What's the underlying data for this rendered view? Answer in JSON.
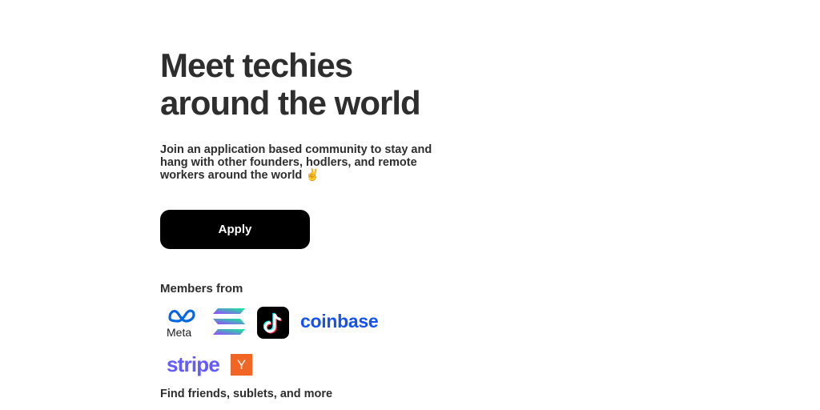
{
  "hero": {
    "title_line_1": "Meet techies",
    "title_line_2": "around the world",
    "subtitle_line_1": "Join an application based community to stay and",
    "subtitle_line_2": "hang with other founders,  hodlers, and remote",
    "subtitle_line_3": "workers around the world ✌️"
  },
  "cta": {
    "apply_label": "Apply"
  },
  "members": {
    "label": "Members from",
    "logos": {
      "meta": "Meta",
      "solana": "solana-logo",
      "tiktok": "tiktok-logo",
      "coinbase": "coinbase",
      "stripe": "stripe",
      "ycombinator": "Y"
    }
  },
  "footer": {
    "find_label": "Find friends, sublets, and more"
  },
  "colors": {
    "button_bg": "#000000",
    "coinbase_blue": "#1652f0",
    "stripe_purple": "#635bff",
    "yc_orange": "#f26625",
    "meta_blue": "#0668e1"
  }
}
